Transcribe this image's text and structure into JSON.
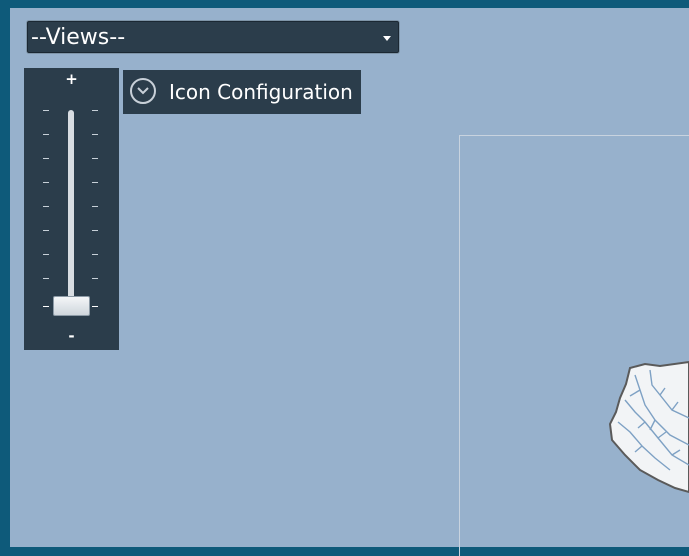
{
  "views_dropdown": {
    "selected": "--Views--"
  },
  "zoom_control": {
    "plus_label": "+",
    "minus_label": "-",
    "level": 0.0
  },
  "icon_configuration": {
    "label": "Icon Configuration",
    "icon": "chevron-down-icon"
  },
  "colors": {
    "panel_bg": "#2b3d4b",
    "map_bg": "#97b1cc",
    "frame_bg": "#0e5a7a"
  }
}
